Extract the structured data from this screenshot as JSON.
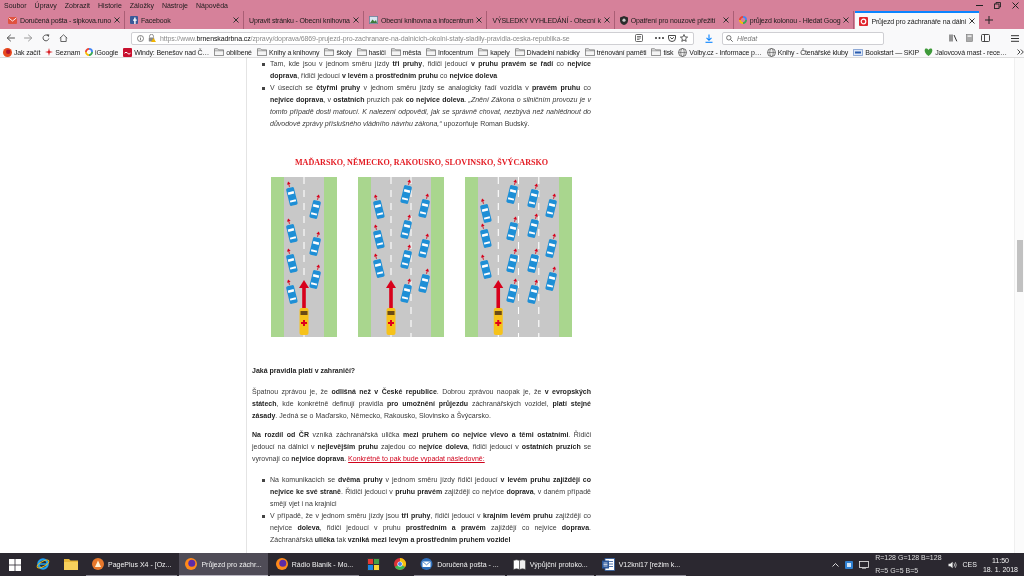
{
  "window": {
    "menu": [
      "Soubor",
      "Úpravy",
      "Zobrazit",
      "Historie",
      "Záložky",
      "Nástroje",
      "Nápověda"
    ]
  },
  "tabs": [
    {
      "title": "Doručená pošta - sipkova.runo",
      "selected": false
    },
    {
      "title": "Facebook",
      "selected": false
    },
    {
      "title": "Upravit stránku - Obecní knihovna",
      "selected": false
    },
    {
      "title": "Obecní knihovna a infocentrum",
      "selected": false
    },
    {
      "title": "VÝSLEDKY VYHLEDÁNÍ - Obecní k",
      "selected": false
    },
    {
      "title": "Opatření pro nouzové přežití",
      "selected": false
    },
    {
      "title": "průjezd kolonou - Hledat Goog",
      "selected": false
    },
    {
      "title": "Průjezd pro záchranáře na dálni",
      "selected": true
    }
  ],
  "toolbar": {
    "url": "https://www.**brnenskadrbna.cz**/zpravy/doprava/6869-prujezd-pro-zachranare-na-dalnicich-okolni-staty-sladily-pravidla-ceska-republika-se",
    "search": {
      "placeholder": "Hledat"
    }
  },
  "bookmarks": [
    {
      "label": "Jak začít",
      "kind": "page"
    },
    {
      "label": "Seznam",
      "kind": "page"
    },
    {
      "label": "iGoogle",
      "kind": "page"
    },
    {
      "label": "Windy: Benešov nad Č…",
      "kind": "page"
    },
    {
      "label": "oblíbené",
      "kind": "folder"
    },
    {
      "label": "Knihy a knihovny",
      "kind": "folder"
    },
    {
      "label": "školy",
      "kind": "folder"
    },
    {
      "label": "hasiči",
      "kind": "folder"
    },
    {
      "label": "města",
      "kind": "folder"
    },
    {
      "label": "Infocentrum",
      "kind": "folder"
    },
    {
      "label": "kapely",
      "kind": "folder"
    },
    {
      "label": "Divadelní nabídky",
      "kind": "folder"
    },
    {
      "label": "trénování paměti",
      "kind": "folder"
    },
    {
      "label": "tisk",
      "kind": "folder"
    },
    {
      "label": "Volby.cz - Informace p…",
      "kind": "page"
    },
    {
      "label": "Knihy - Čtenářské kluby",
      "kind": "page"
    },
    {
      "label": "Bookstart — SKIP",
      "kind": "page"
    },
    {
      "label": "Jalovcová mast - rece…",
      "kind": "page"
    }
  ],
  "article": {
    "blocks": [
      {
        "kind": "bullets",
        "items": [
          "Tam, kde jsou v jednom směru jízdy **tři pruhy**, řidiči jedoucí **v pruhu pravém se řadí** co **nejvíce doprava**, řidiči jedoucí **v levém** a **prostředním pruhu** co **nejvíce doleva**",
          "V úsecích se **čtyřmi pruhy** v jednom směru jízdy se analogicky řadí vozidla v **pravém pruhu** co **nejvíce doprava**, v **ostatních** pruzích pak **co nejvíce doleva**. *„Znění Zákona o silničním provozu je v tomto případě dosti matoucí. K nalezení odpovědi, jak se správně chovat, nezbývá než nahlédnout do důvodové zprávy příslušného vládního návrhu zákona,“* upozorňuje Roman Budský."
        ]
      },
      {
        "kind": "figure",
        "title": "MAĎARSKO, NĚMECKO, RAKOUSKO, SLOVINSKO, ŠVÝCARSKO"
      },
      {
        "kind": "heading",
        "text": "Jaká pravidla platí v zahraničí?"
      },
      {
        "kind": "paragraph",
        "text": "Špatnou zprávou je, že **odlišná než v České republice**. Dobrou zprávou naopak je, že **v evropských státech**, kde konkrétně definují pravidla **pro umožnění průjezdu** záchranářských vozidel, **platí stejné zásady**. Jedná se o Maďarsko, Německo, Rakousko, Slovinsko a Švýcarsko."
      },
      {
        "kind": "paragraph",
        "text": "**Na rozdíl od ČR** vzniká záchranářská ulička **mezi pruhem co nejvíce vlevo a těmi ostatními**. Řidiči jedoucí na dálnici v **nejlevějším pruhu** zajedou co **nejvíce doleva**, řidiči jedoucí v **ostatních pruzích** se vyrovnají co **nejvíce doprava**.",
        "link": "Konkrétně to pak bude vypadat následovně:"
      },
      {
        "kind": "bullets",
        "items": [
          "Na komunikacích se **dvěma pruhy** v jednom směru jízdy řidiči jedoucí **v levém pruhu zajíždějí co nejvíce ke své straně**. Řidiči jedoucí v **pruhu pravém** zajíždějí co nejvíce **doprava**, v daném případě smějí vjet i na krajnici",
          "V případě, že v jednom směru jízdy jsou **tři pruhy**, řidiči jedoucí v **krajním levém pruhu** zajíždějí co nejvíce **doleva**, řidiči jedoucí v pruhu **prostředním a pravém** zajíždějí co nejvíce **doprava**. Záchranářská **ulička** tak **vzniká mezi levým a prostředním pruhem vozidel**"
        ]
      }
    ]
  },
  "taskbar": {
    "apps": [
      {
        "selected": false
      },
      {
        "selected": false
      },
      {
        "label": "PagePlus X4 - [Oz...",
        "selected": false
      },
      {
        "label": "Průjezd pro záchr...",
        "selected": true
      },
      {
        "label": "Rádio Blaník - Mo...",
        "selected": false
      },
      {
        "selected": false
      },
      {
        "selected": false
      },
      {
        "label": "Doručená pošta - ...",
        "selected": false
      },
      {
        "label": "Výpůjční protoko...",
        "selected": false
      },
      {
        "label": "V12kni17 [režim k...",
        "selected": false
      }
    ],
    "tray": {
      "readout": [
        "R=128 G=128 B=128",
        "R=5 G=5 B=5"
      ],
      "language": "CES",
      "time": "11:50",
      "date": "18. 1. 2018"
    }
  }
}
